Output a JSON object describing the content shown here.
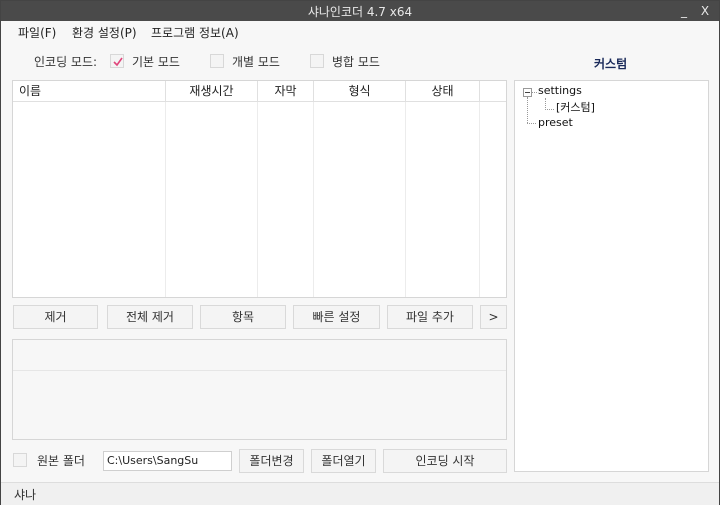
{
  "window": {
    "title": "샤나인코더 4.7 x64",
    "minimize": "_",
    "close": "X"
  },
  "menu": [
    {
      "label": "파일(F)"
    },
    {
      "label": "환경 설정(P)"
    },
    {
      "label": "프로그램 정보(A)"
    }
  ],
  "encoding_mode": {
    "label": "인코딩 모드:",
    "options": [
      {
        "label": "기본 모드",
        "checked": true
      },
      {
        "label": "개별 모드",
        "checked": false
      },
      {
        "label": "병합 모드",
        "checked": false
      }
    ]
  },
  "file_table": {
    "columns": [
      "이름",
      "재생시간",
      "자막",
      "형식",
      "상태"
    ],
    "rows": []
  },
  "actions": {
    "remove": "제거",
    "remove_all": "전체 제거",
    "items": "항목",
    "quick_settings": "빠른 설정",
    "add_file": "파일 추가",
    "more": ">"
  },
  "output": {
    "source_folder_label": "원본 폴더",
    "source_folder_checked": false,
    "folder_path": "C:\\Users\\SangSu",
    "change_folder": "폴더변경",
    "open_folder": "폴더열기",
    "start_encoding": "인코딩 시작"
  },
  "custom_panel": {
    "title": "커스텀",
    "tree": {
      "root": "settings",
      "child": "[커스텀]",
      "sibling": "preset"
    }
  },
  "status": {
    "text": "샤나"
  },
  "colors": {
    "titlebar": "#4a4a4a",
    "checkmark": "#e0457b"
  }
}
